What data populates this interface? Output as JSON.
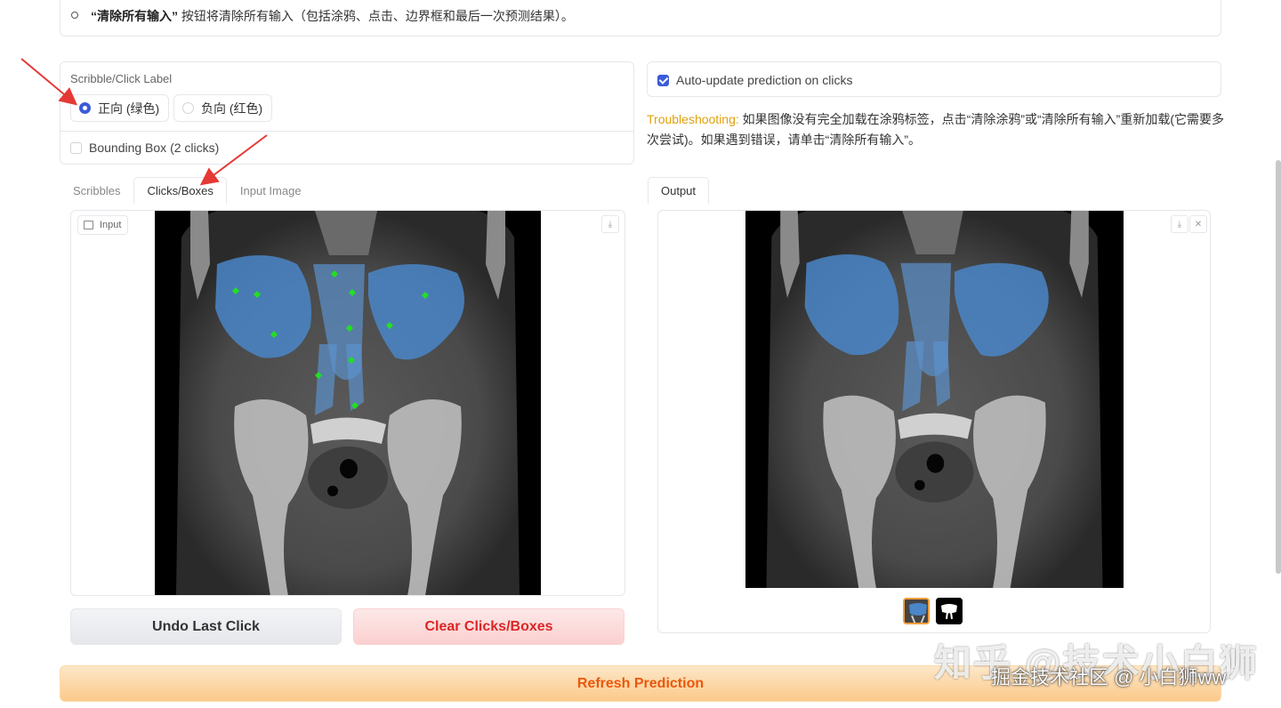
{
  "instructions": {
    "clear_all_bold": "“清除所有输入”",
    "clear_all_text": " 按钮将清除所有输入（包括涂鸦、点击、边界框和最后一次预测结果）。"
  },
  "label_panel": {
    "title": "Scribble/Click Label",
    "options": [
      {
        "label": "正向 (绿色)",
        "selected": true
      },
      {
        "label": "负向 (红色)",
        "selected": false
      }
    ],
    "bounding_box_label": "Bounding Box (2 clicks)",
    "bounding_box_checked": false
  },
  "auto_update": {
    "label": "Auto-update prediction on clicks",
    "checked": true
  },
  "troubleshooting": {
    "label": "Troubleshooting:",
    "text": " 如果图像没有完全加载在涂鸦标签，点击“清除涂鸦”或“清除所有输入”重新加载(它需要多次尝试)。如果遇到错误，请单击“清除所有输入”。"
  },
  "input_tabs": [
    "Scribbles",
    "Clicks/Boxes",
    "Input Image"
  ],
  "input_active_tab": "Clicks/Boxes",
  "input_chip": "Input",
  "output_tab": "Output",
  "buttons": {
    "undo": "Undo Last Click",
    "clear": "Clear Clicks/Boxes",
    "refresh": "Refresh Prediction"
  },
  "icons": {
    "download": "download-icon",
    "close": "close-icon",
    "image": "image-icon"
  },
  "colors": {
    "accent": "#3b5bdb",
    "positive_click": "#22e022",
    "segmentation": "#4a86c8",
    "troubleshoot_label": "#e0a10b",
    "clear_button_text": "#dc2626",
    "refresh_button_text": "#ea580c",
    "annotation_arrow": "#e53935"
  },
  "watermark": {
    "line1": "知乎 @技术小白狮",
    "line2": "掘金技术社区 @ 小白狮ww"
  }
}
